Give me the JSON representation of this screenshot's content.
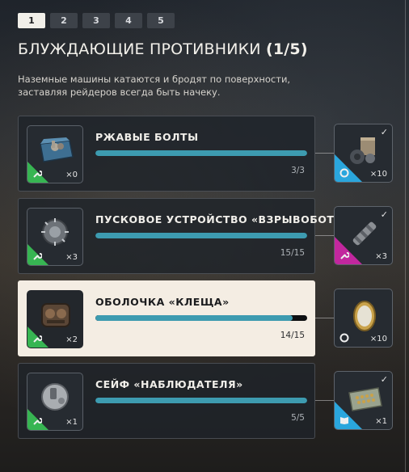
{
  "tabs": [
    {
      "label": "1",
      "active": true
    },
    {
      "label": "2",
      "active": false
    },
    {
      "label": "3",
      "active": false
    },
    {
      "label": "4",
      "active": false
    },
    {
      "label": "5",
      "active": false
    }
  ],
  "header": {
    "title": "БЛУЖДАЮЩИЕ ПРОТИВНИКИ",
    "count": "(1/5)",
    "description": "Наземные машины катаются и бродят по поверхности, заставляя рейдеров всегда быть начеку."
  },
  "objectives": [
    {
      "name": "РЖАВЫЕ БОЛТЫ",
      "item_icon": "rusty-bolts-icon",
      "owned": "×0",
      "progress_text": "3/3",
      "progress": 1.0,
      "highlighted": false,
      "reward": {
        "icon": "supply-crate-icon",
        "rarity_color": "#2aa6dd",
        "qty": "×10",
        "completed": true,
        "type_icon": "parts-icon"
      }
    },
    {
      "name": "ПУСКОВОЕ УСТРОЙСТВО «ВЗРЫВОБОТА»",
      "item_icon": "launcher-device-icon",
      "owned": "×3",
      "progress_text": "15/15",
      "progress": 1.0,
      "highlighted": false,
      "reward": {
        "icon": "barrel-mod-icon",
        "rarity_color": "#c2279e",
        "qty": "×3",
        "completed": true,
        "type_icon": "wrench-icon"
      }
    },
    {
      "name": "ОБОЛОЧКА «КЛЕЩА»",
      "item_icon": "tick-shell-icon",
      "owned": "×2",
      "progress_text": "14/15",
      "progress": 0.933,
      "highlighted": true,
      "reward": {
        "icon": "mirror-icon",
        "rarity_color": "#262b31",
        "qty": "×10",
        "completed": false,
        "type_icon": "parts-icon"
      }
    },
    {
      "name": "СЕЙФ «НАБЛЮДАТЕЛЯ»",
      "item_icon": "observer-safe-icon",
      "owned": "×1",
      "progress_text": "5/5",
      "progress": 1.0,
      "highlighted": false,
      "reward": {
        "icon": "toolbox-icon",
        "rarity_color": "#2aa6dd",
        "qty": "×1",
        "completed": true,
        "type_icon": "book-icon"
      }
    }
  ]
}
